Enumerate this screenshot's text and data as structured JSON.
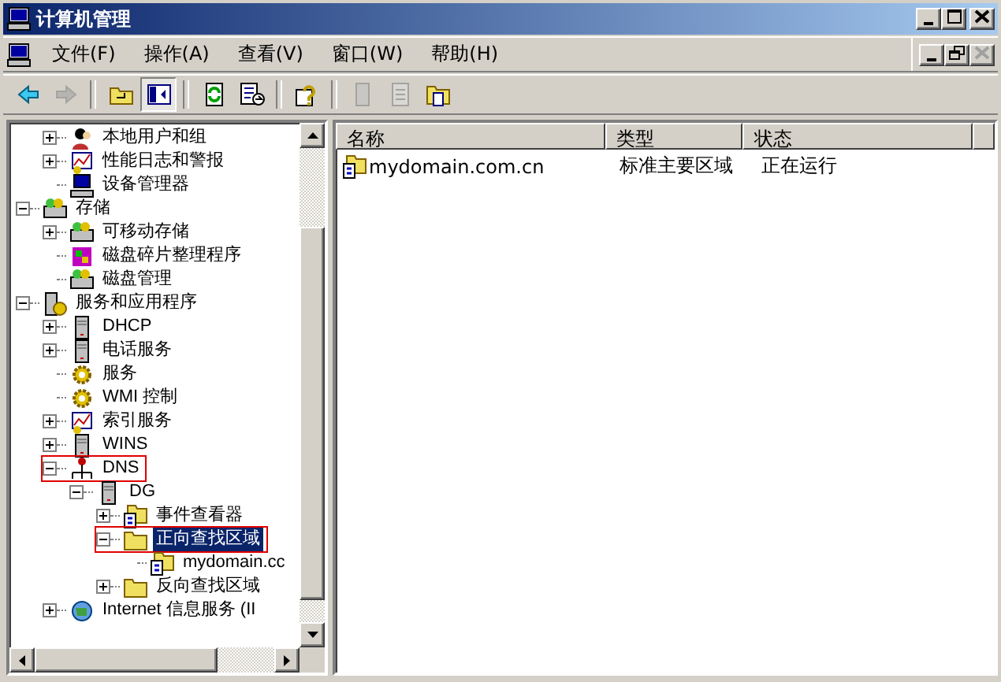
{
  "window": {
    "title": "计算机管理"
  },
  "menu": [
    "文件(F)",
    "操作(A)",
    "查看(V)",
    "窗口(W)",
    "帮助(H)"
  ],
  "child_controls": [
    {
      "kind": "minimize",
      "disabled": false
    },
    {
      "kind": "restore",
      "disabled": false
    },
    {
      "kind": "close",
      "disabled": true
    }
  ],
  "toolbar": [
    {
      "kind": "back",
      "disabled": false,
      "pressed": false
    },
    {
      "kind": "forward",
      "disabled": true,
      "pressed": false
    },
    {
      "kind": "separator"
    },
    {
      "kind": "up",
      "disabled": false,
      "pressed": false
    },
    {
      "kind": "tree",
      "disabled": false,
      "pressed": true
    },
    {
      "kind": "separator"
    },
    {
      "kind": "refresh",
      "disabled": false,
      "pressed": false
    },
    {
      "kind": "export",
      "disabled": false,
      "pressed": false
    },
    {
      "kind": "separator"
    },
    {
      "kind": "help",
      "disabled": false,
      "pressed": false
    },
    {
      "kind": "separator"
    },
    {
      "kind": "page",
      "disabled": true,
      "pressed": false
    },
    {
      "kind": "notes",
      "disabled": true,
      "pressed": false
    },
    {
      "kind": "folders",
      "disabled": false,
      "pressed": false
    }
  ],
  "tree": [
    {
      "children": [
        {
          "label": "本地用户和组",
          "kind": "users",
          "expanded": false,
          "selected": false,
          "annotated": false
        },
        {
          "label": "性能日志和警报",
          "kind": "chart",
          "expanded": false,
          "selected": false,
          "annotated": false
        },
        {
          "label": "设备管理器",
          "kind": "computer",
          "selected": false,
          "annotated": false
        }
      ]
    },
    {
      "label": "存储",
      "kind": "drive",
      "expanded": true,
      "selected": false,
      "annotated": false,
      "children": [
        {
          "label": "可移动存储",
          "kind": "drive",
          "expanded": false,
          "selected": false,
          "annotated": false
        },
        {
          "label": "磁盘碎片整理程序",
          "kind": "defrag",
          "selected": false,
          "annotated": false
        },
        {
          "label": "磁盘管理",
          "kind": "drive",
          "selected": false,
          "annotated": false
        }
      ]
    },
    {
      "label": "服务和应用程序",
      "kind": "services",
      "expanded": true,
      "selected": false,
      "annotated": false,
      "children": [
        {
          "label": "DHCP",
          "kind": "server",
          "expanded": false,
          "selected": false,
          "annotated": false
        },
        {
          "label": "电话服务",
          "kind": "server",
          "expanded": false,
          "selected": false,
          "annotated": false
        },
        {
          "label": "服务",
          "kind": "gear",
          "selected": false,
          "annotated": false
        },
        {
          "label": "WMI 控制",
          "kind": "gear",
          "selected": false,
          "annotated": false
        },
        {
          "label": "索引服务",
          "kind": "chart",
          "expanded": false,
          "selected": false,
          "annotated": false
        },
        {
          "label": "WINS",
          "kind": "server",
          "expanded": false,
          "selected": false,
          "annotated": false
        },
        {
          "label": "DNS",
          "kind": "network",
          "expanded": true,
          "selected": false,
          "annotated": true,
          "children": [
            {
              "label": "DG",
              "kind": "server",
              "expanded": true,
              "selected": false,
              "annotated": false,
              "children": [
                {
                  "label": "事件查看器",
                  "kind": "zone",
                  "expanded": false,
                  "selected": false,
                  "annotated": false
                },
                {
                  "label": "正向查找区域",
                  "kind": "folder",
                  "expanded": true,
                  "selected": true,
                  "annotated": true,
                  "children": [
                    {
                      "label": "mydomain.cc",
                      "kind": "zone",
                      "selected": false,
                      "annotated": false
                    }
                  ]
                },
                {
                  "label": "反向查找区域",
                  "kind": "folder",
                  "expanded": false,
                  "selected": false,
                  "annotated": false
                }
              ]
            }
          ]
        },
        {
          "label": "Internet 信息服务 (II",
          "kind": "globe",
          "expanded": false,
          "selected": false,
          "annotated": false
        }
      ]
    }
  ],
  "list": {
    "columns": [
      "名称",
      "类型",
      "状态"
    ],
    "rows": [
      {
        "cells": [
          "mydomain.com.cn",
          "标准主要区域",
          "正在运行"
        ],
        "kind": "zone",
        "selected": false
      }
    ]
  }
}
